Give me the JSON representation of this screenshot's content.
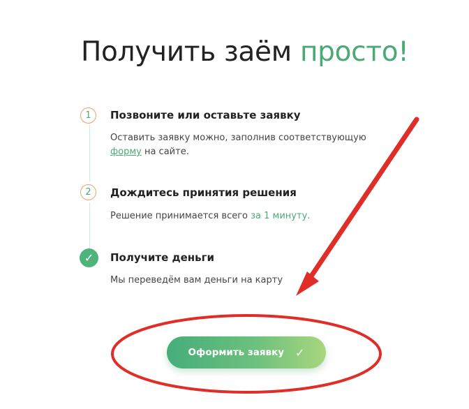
{
  "title": {
    "part1": "Получить заём ",
    "accent": "просто!"
  },
  "colors": {
    "accent": "#4aa974",
    "annotation": "#e02d27"
  },
  "steps": [
    {
      "marker": "1",
      "title": "Позвоните или оставьте заявку",
      "text_line1": "Оставить заявку можно, заполнив соответствующую",
      "link": "форму",
      "text_after_link": " на сайте."
    },
    {
      "marker": "2",
      "title": "Дождитесь принятия решения",
      "text_before_link": "Решение принимается всего ",
      "link": "за 1 минуту."
    },
    {
      "marker": "✓",
      "title": "Получите деньги",
      "text": "Мы переведём вам деньги на карту"
    }
  ],
  "cta": {
    "label": "Оформить заявку",
    "icon": "check-icon",
    "check": "✓"
  }
}
